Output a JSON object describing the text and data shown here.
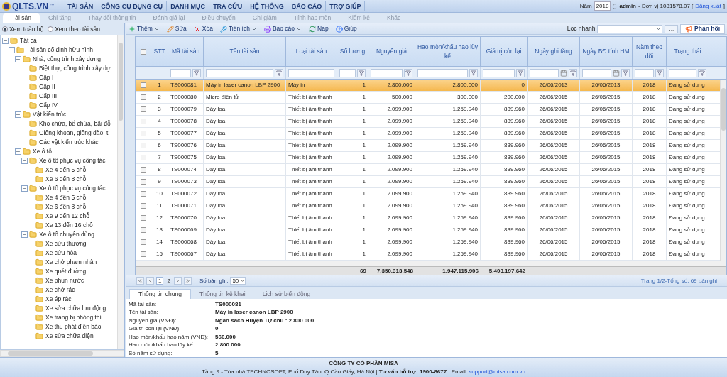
{
  "logo": {
    "text": "QLTS.VN",
    "mark": "™"
  },
  "menu": [
    "TÀI SẢN",
    "CÔNG CỤ DỤNG CỤ",
    "DANH MỤC",
    "TRA CỨU",
    "HỆ THỐNG",
    "BÁO CÁO",
    "TRỢ GIÚP"
  ],
  "account": {
    "year_label": "Năm",
    "year": "2018",
    "user": "admin",
    "unit": "- Đơn vị 1081578.07 [",
    "logout": "Đăng xuất",
    "close": "]"
  },
  "tabs": [
    {
      "label": "Tài sản",
      "selected": true
    },
    {
      "label": "Ghi tăng",
      "selected": false
    },
    {
      "label": "Thay đổi thông tin",
      "selected": false
    },
    {
      "label": "Đánh giá lại",
      "selected": false
    },
    {
      "label": "Điều chuyển",
      "selected": false
    },
    {
      "label": "Ghi giảm",
      "selected": false
    },
    {
      "label": "Tính hao mòn",
      "selected": false
    },
    {
      "label": "Kiểm kê",
      "selected": false
    },
    {
      "label": "Khác",
      "selected": false
    }
  ],
  "view_options": [
    {
      "label": "Xem toàn bộ",
      "selected": true
    },
    {
      "label": "Xem theo tài sản",
      "selected": false
    }
  ],
  "tree": [
    {
      "label": "Tất cả",
      "expanded": true,
      "children": [
        {
          "label": "Tài sản cố định hữu hình",
          "expanded": true,
          "children": [
            {
              "label": "Nhà, công trình xây dựng",
              "expanded": true,
              "children": [
                {
                  "label": "Biệt thự, công trình xây dự"
                },
                {
                  "label": "Cấp I"
                },
                {
                  "label": "Cấp II"
                },
                {
                  "label": "Cấp III"
                },
                {
                  "label": "Cấp IV"
                }
              ]
            },
            {
              "label": "Vật kiến trúc",
              "expanded": true,
              "children": [
                {
                  "label": "Kho chứa, bể chứa, bãi đỗ"
                },
                {
                  "label": "Giếng khoan, giếng đào, t"
                },
                {
                  "label": "Các vật kiến trúc khác"
                }
              ]
            },
            {
              "label": "Xe ô tô",
              "expanded": true,
              "children": [
                {
                  "label": "Xe ô tô phục vụ công tác",
                  "expanded": true,
                  "children": [
                    {
                      "label": "Xe 4 đến 5 chỗ"
                    },
                    {
                      "label": "Xe 6 đến 8 chỗ"
                    }
                  ]
                },
                {
                  "label": "Xe ô tô phục vụ công tác",
                  "expanded": true,
                  "children": [
                    {
                      "label": "Xe 4 đến 5 chỗ"
                    },
                    {
                      "label": "Xe 6 đến 8 chỗ"
                    },
                    {
                      "label": "Xe 9 đến 12 chỗ"
                    },
                    {
                      "label": "Xe 13 đến 16 chỗ"
                    }
                  ]
                },
                {
                  "label": "Xe ô tô chuyên dùng",
                  "expanded": true,
                  "children": [
                    {
                      "label": "Xe cứu thương"
                    },
                    {
                      "label": "Xe cứu hỏa"
                    },
                    {
                      "label": "Xe chở phạm nhân"
                    },
                    {
                      "label": "Xe quét đường"
                    },
                    {
                      "label": "Xe phun nước"
                    },
                    {
                      "label": "Xe chở rác"
                    },
                    {
                      "label": "Xe ép rác"
                    },
                    {
                      "label": "Xe sửa chữa lưu động"
                    },
                    {
                      "label": "Xe trang bị phòng thí"
                    },
                    {
                      "label": "Xe thu phát điện báo"
                    },
                    {
                      "label": "Xe sửa chữa điện"
                    }
                  ]
                }
              ]
            }
          ]
        }
      ]
    }
  ],
  "toolbar": [
    {
      "label": "Thêm",
      "kind": "dropdown"
    },
    {
      "label": "Sửa",
      "kind": "plain"
    },
    {
      "label": "Xóa",
      "kind": "plain"
    },
    {
      "label": "Tiện ích",
      "kind": "dropdown"
    },
    {
      "label": "Báo cáo",
      "kind": "dropdown"
    },
    {
      "label": "Nạp",
      "kind": "plain"
    },
    {
      "label": "Giúp",
      "kind": "plain"
    }
  ],
  "quick_filter": {
    "label": "Lọc nhanh",
    "more": "...",
    "feedback": "Phản hồi"
  },
  "table": {
    "all_checked": false,
    "columns": [
      {
        "label": "STT",
        "kind": "none"
      },
      {
        "label": "Mã tài sản",
        "kind": "text"
      },
      {
        "label": "Tên tài sản",
        "kind": "text"
      },
      {
        "label": "Loại tài sản",
        "kind": "plain"
      },
      {
        "label": "Số lượng",
        "kind": "text",
        "total": "69"
      },
      {
        "label": "Nguyên giá",
        "kind": "text",
        "total": "7.350.313.548"
      },
      {
        "label": "Hao mòn/khấu hao lũy kế",
        "kind": "text",
        "total": "1.947.115.906"
      },
      {
        "label": "Giá trị còn lại",
        "kind": "text",
        "total": "5.403.197.642"
      },
      {
        "label": "Ngày ghi tăng",
        "kind": "date"
      },
      {
        "label": "Ngày BĐ tính HM",
        "kind": "date"
      },
      {
        "label": "Năm theo dõi",
        "kind": "text"
      },
      {
        "label": "Trạng thái",
        "kind": "text"
      }
    ],
    "rows": [
      {
        "selected": true,
        "checked": false,
        "cells": [
          "1",
          "TS000081",
          "Máy in laser canon LBP 2900",
          "Máy in",
          "1",
          "2.800.000",
          "2.800.000",
          "0",
          "26/06/2013",
          "26/06/2013",
          "2018",
          "Đang sử dụng"
        ]
      },
      {
        "selected": false,
        "checked": false,
        "cells": [
          "2",
          "TS000080",
          "Micro điện tử",
          "Thiết bị âm thanh",
          "1",
          "500.000",
          "300.000",
          "200.000",
          "26/06/2015",
          "26/06/2015",
          "2018",
          "Đang sử dụng"
        ]
      },
      {
        "selected": false,
        "checked": false,
        "cells": [
          "3",
          "TS000079",
          "Dây loa",
          "Thiết bị âm thanh",
          "1",
          "2.099.900",
          "1.259.940",
          "839.960",
          "26/06/2015",
          "26/06/2015",
          "2018",
          "Đang sử dụng"
        ]
      },
      {
        "selected": false,
        "checked": false,
        "cells": [
          "4",
          "TS000078",
          "Dây loa",
          "Thiết bị âm thanh",
          "1",
          "2.099.900",
          "1.259.940",
          "839.960",
          "26/06/2015",
          "26/06/2015",
          "2018",
          "Đang sử dụng"
        ]
      },
      {
        "selected": false,
        "checked": false,
        "cells": [
          "5",
          "TS000077",
          "Dây loa",
          "Thiết bị âm thanh",
          "1",
          "2.099.900",
          "1.259.940",
          "839.960",
          "26/06/2015",
          "26/06/2015",
          "2018",
          "Đang sử dụng"
        ]
      },
      {
        "selected": false,
        "checked": false,
        "cells": [
          "6",
          "TS000076",
          "Dây loa",
          "Thiết bị âm thanh",
          "1",
          "2.099.900",
          "1.259.940",
          "839.960",
          "26/06/2015",
          "26/06/2015",
          "2018",
          "Đang sử dụng"
        ]
      },
      {
        "selected": false,
        "checked": false,
        "cells": [
          "7",
          "TS000075",
          "Dây loa",
          "Thiết bị âm thanh",
          "1",
          "2.099.900",
          "1.259.940",
          "839.960",
          "26/06/2015",
          "26/06/2015",
          "2018",
          "Đang sử dụng"
        ]
      },
      {
        "selected": false,
        "checked": false,
        "cells": [
          "8",
          "TS000074",
          "Dây loa",
          "Thiết bị âm thanh",
          "1",
          "2.099.900",
          "1.259.940",
          "839.960",
          "26/06/2015",
          "26/06/2015",
          "2018",
          "Đang sử dụng"
        ]
      },
      {
        "selected": false,
        "checked": false,
        "cells": [
          "9",
          "TS000073",
          "Dây loa",
          "Thiết bị âm thanh",
          "1",
          "2.099.900",
          "1.259.940",
          "839.960",
          "26/06/2015",
          "26/06/2015",
          "2018",
          "Đang sử dụng"
        ]
      },
      {
        "selected": false,
        "checked": false,
        "cells": [
          "10",
          "TS000072",
          "Dây loa",
          "Thiết bị âm thanh",
          "1",
          "2.099.900",
          "1.259.940",
          "839.960",
          "26/06/2015",
          "26/06/2015",
          "2018",
          "Đang sử dụng"
        ]
      },
      {
        "selected": false,
        "checked": false,
        "cells": [
          "11",
          "TS000071",
          "Dây loa",
          "Thiết bị âm thanh",
          "1",
          "2.099.900",
          "1.259.940",
          "839.960",
          "26/06/2015",
          "26/06/2015",
          "2018",
          "Đang sử dụng"
        ]
      },
      {
        "selected": false,
        "checked": false,
        "cells": [
          "12",
          "TS000070",
          "Dây loa",
          "Thiết bị âm thanh",
          "1",
          "2.099.900",
          "1.259.940",
          "839.960",
          "26/06/2015",
          "26/06/2015",
          "2018",
          "Đang sử dụng"
        ]
      },
      {
        "selected": false,
        "checked": false,
        "cells": [
          "13",
          "TS000069",
          "Dây loa",
          "Thiết bị âm thanh",
          "1",
          "2.099.900",
          "1.259.940",
          "839.960",
          "26/06/2015",
          "26/06/2015",
          "2018",
          "Đang sử dụng"
        ]
      },
      {
        "selected": false,
        "checked": false,
        "cells": [
          "14",
          "TS000068",
          "Dây loa",
          "Thiết bị âm thanh",
          "1",
          "2.099.900",
          "1.259.940",
          "839.960",
          "26/06/2015",
          "26/06/2015",
          "2018",
          "Đang sử dụng"
        ]
      },
      {
        "selected": false,
        "checked": false,
        "cells": [
          "15",
          "TS000067",
          "Dây loa",
          "Thiết bị âm thanh",
          "1",
          "2.099.900",
          "1.259.940",
          "839.960",
          "26/06/2015",
          "26/06/2015",
          "2018",
          "Đang sử dụng"
        ]
      }
    ]
  },
  "pager": {
    "pages": [
      {
        "label": "1",
        "selected": true
      },
      {
        "label": "2",
        "selected": false
      }
    ],
    "size_label": "Số bản ghi:",
    "size": "50",
    "summary": "Trang 1/2-Tổng số: 69 bản ghi"
  },
  "detail_tabs": [
    {
      "label": "Thông tin chung",
      "selected": true
    },
    {
      "label": "Thông tin kê khai",
      "selected": false
    },
    {
      "label": "Lịch sử biến động",
      "selected": false
    }
  ],
  "details": [
    {
      "label": "Mã tài sản:",
      "value": "TS000081"
    },
    {
      "label": "Tên tài sản:",
      "value": "Máy in laser canon LBP 2900"
    },
    {
      "label": "Nguyên giá (VNĐ):",
      "value": "Ngân sách Huyện Tự chủ : 2.800.000"
    },
    {
      "label": "Giá trị còn lại (VNĐ):",
      "value": "0"
    },
    {
      "label": "Hao mòn/khấu hao năm (VNĐ):",
      "value": "560.000"
    },
    {
      "label": "Hao mòn/khấu hao lũy kế:",
      "value": "2.800.000"
    },
    {
      "label": "Số năm sử dụng:",
      "value": "5"
    }
  ],
  "footer": {
    "company": "CÔNG TY CỔ PHẦN MISA",
    "address": "Tầng 9 - Tòa nhà TECHNOSOFT, Phố Duy Tân, Q.Cầu Giấy, Hà Nội | **Tư vấn hỗ trợ: 1900-8677** | Email: ",
    "email": "support@misa.com.vn"
  }
}
